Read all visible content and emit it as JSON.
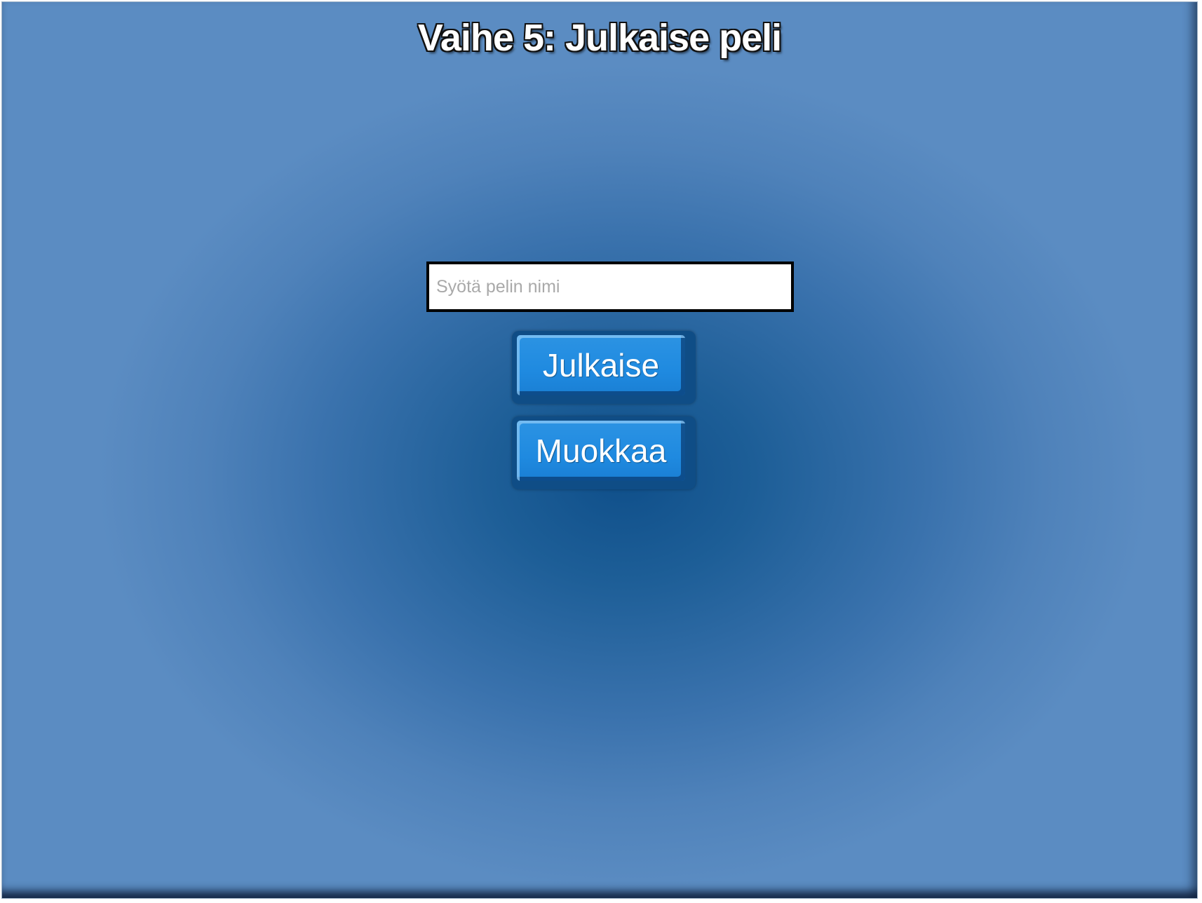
{
  "page": {
    "title": "Vaihe 5: Julkaise peli"
  },
  "form": {
    "name_input": {
      "value": "",
      "placeholder": "Syötä pelin nimi"
    },
    "publish_label": "Julkaise",
    "edit_label": "Muokkaa"
  },
  "colors": {
    "background_center": "#0f4f8a",
    "background_edge": "#5b8cc2",
    "button_fill": "#1f8ae0",
    "button_border": "#0f4d86",
    "input_border": "#000000"
  }
}
